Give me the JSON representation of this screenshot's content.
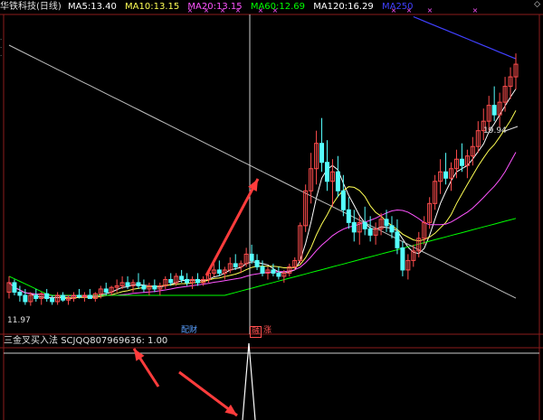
{
  "colors": {
    "bg": "#000000",
    "up": "#ff4d4d",
    "down": "#54ffff",
    "axis": "#8b1c1c",
    "ma5": "#ffffff",
    "ma10": "#ffff54",
    "ma20": "#ff54ff",
    "ma60": "#00ff00",
    "ma120": "#ffffff",
    "ma250": "#4040ff",
    "cursor": "#cfcfcf",
    "arrow": "#ff3c3c",
    "text": "#e0e0e0",
    "label": "#ff4d4d"
  },
  "header": {
    "title": "华铁科技(日线)",
    "ma5_label": "MA5:",
    "ma5_value": "13.40",
    "ma10_label": "MA10:",
    "ma10_value": "13.15",
    "ma20_label": "MA20:",
    "ma20_value": "13.15",
    "ma60_label": "MA60:",
    "ma60_value": "12.69",
    "ma120_label": "MA120:",
    "ma120_value": "16.29",
    "ma250_label": "MA250"
  },
  "price_labels": {
    "high": "19.94",
    "low": "11.97"
  },
  "badges": {
    "b1": "配财",
    "b2": "融",
    "b3": "涨"
  },
  "indicator": {
    "name": "三金叉买入法",
    "code": "SCJQQ807969636:",
    "value": "1.00"
  },
  "scroll_marker": "◇",
  "chart_data": {
    "type": "candlestick",
    "note": "daily candles approximated from screenshot",
    "candles": [
      [
        12.4,
        12.9,
        12.2,
        12.7
      ],
      [
        12.7,
        12.8,
        12.3,
        12.4
      ],
      [
        12.4,
        12.6,
        12.1,
        12.3
      ],
      [
        12.3,
        12.5,
        12.0,
        12.1
      ],
      [
        12.1,
        12.4,
        11.97,
        12.3
      ],
      [
        12.3,
        12.5,
        12.1,
        12.2
      ],
      [
        12.2,
        12.4,
        12.0,
        12.35
      ],
      [
        12.35,
        12.5,
        12.1,
        12.2
      ],
      [
        12.2,
        12.3,
        12.0,
        12.1
      ],
      [
        12.1,
        12.4,
        12.0,
        12.3
      ],
      [
        12.3,
        12.4,
        12.1,
        12.15
      ],
      [
        12.15,
        12.3,
        12.0,
        12.2
      ],
      [
        12.2,
        12.4,
        12.1,
        12.3
      ],
      [
        12.3,
        12.5,
        12.2,
        12.25
      ],
      [
        12.25,
        12.4,
        12.1,
        12.3
      ],
      [
        12.3,
        12.5,
        12.2,
        12.2
      ],
      [
        12.2,
        12.4,
        12.1,
        12.35
      ],
      [
        12.35,
        12.6,
        12.2,
        12.5
      ],
      [
        12.5,
        12.7,
        12.3,
        12.4
      ],
      [
        12.4,
        12.6,
        12.3,
        12.55
      ],
      [
        12.55,
        12.8,
        12.4,
        12.6
      ],
      [
        12.6,
        12.9,
        12.5,
        12.7
      ],
      [
        12.7,
        12.9,
        12.5,
        12.6
      ],
      [
        12.6,
        12.8,
        12.4,
        12.7
      ],
      [
        12.7,
        13.0,
        12.5,
        12.6
      ],
      [
        12.6,
        12.8,
        12.4,
        12.5
      ],
      [
        12.5,
        12.7,
        12.3,
        12.6
      ],
      [
        12.6,
        12.8,
        12.4,
        12.5
      ],
      [
        12.5,
        12.7,
        12.3,
        12.6
      ],
      [
        12.6,
        12.9,
        12.5,
        12.8
      ],
      [
        12.8,
        13.0,
        12.6,
        12.7
      ],
      [
        12.7,
        13.0,
        12.6,
        12.9
      ],
      [
        12.9,
        13.1,
        12.7,
        12.8
      ],
      [
        12.8,
        13.0,
        12.6,
        12.7
      ],
      [
        12.7,
        12.9,
        12.5,
        12.8
      ],
      [
        12.8,
        13.0,
        12.6,
        12.7
      ],
      [
        12.7,
        12.9,
        12.6,
        12.8
      ],
      [
        12.8,
        13.1,
        12.7,
        13.0
      ],
      [
        13.0,
        13.3,
        12.9,
        13.1
      ],
      [
        13.1,
        13.4,
        12.9,
        13.0
      ],
      [
        13.0,
        13.2,
        12.8,
        13.1
      ],
      [
        13.1,
        13.5,
        13.0,
        13.3
      ],
      [
        13.3,
        13.6,
        13.1,
        13.2
      ],
      [
        13.2,
        13.4,
        13.0,
        13.3
      ],
      [
        13.3,
        13.8,
        13.2,
        13.6
      ],
      [
        13.6,
        13.9,
        13.3,
        13.4
      ],
      [
        13.4,
        13.6,
        13.1,
        13.2
      ],
      [
        13.2,
        13.4,
        12.9,
        13.0
      ],
      [
        13.0,
        13.2,
        12.8,
        13.1
      ],
      [
        13.1,
        13.3,
        12.9,
        13.0
      ],
      [
        13.0,
        13.2,
        12.8,
        12.9
      ],
      [
        12.9,
        13.1,
        12.7,
        13.0
      ],
      [
        13.0,
        13.3,
        12.9,
        13.2
      ],
      [
        13.2,
        13.5,
        13.1,
        13.4
      ],
      [
        13.4,
        14.6,
        13.3,
        14.5
      ],
      [
        14.5,
        15.8,
        14.3,
        15.6
      ],
      [
        15.6,
        16.8,
        15.2,
        16.3
      ],
      [
        16.3,
        17.5,
        15.8,
        17.1
      ],
      [
        17.1,
        17.9,
        16.2,
        16.5
      ],
      [
        16.5,
        17.2,
        15.6,
        15.9
      ],
      [
        15.9,
        16.6,
        15.1,
        16.2
      ],
      [
        16.2,
        16.7,
        15.4,
        15.6
      ],
      [
        15.6,
        16.1,
        14.8,
        15.0
      ],
      [
        15.0,
        15.4,
        14.4,
        14.6
      ],
      [
        14.6,
        15.0,
        14.0,
        14.3
      ],
      [
        14.3,
        14.8,
        13.9,
        14.6
      ],
      [
        14.6,
        15.1,
        14.2,
        14.4
      ],
      [
        14.4,
        14.8,
        14.0,
        14.2
      ],
      [
        14.2,
        14.6,
        13.9,
        14.4
      ],
      [
        14.4,
        14.9,
        14.2,
        14.7
      ],
      [
        14.7,
        15.0,
        14.3,
        14.5
      ],
      [
        14.5,
        14.8,
        14.1,
        14.3
      ],
      [
        14.3,
        14.7,
        13.6,
        13.8
      ],
      [
        13.8,
        14.0,
        12.9,
        13.1
      ],
      [
        13.1,
        13.6,
        12.8,
        13.4
      ],
      [
        13.4,
        13.9,
        13.2,
        13.7
      ],
      [
        13.7,
        14.3,
        13.5,
        14.1
      ],
      [
        14.1,
        14.8,
        13.9,
        14.6
      ],
      [
        14.6,
        15.4,
        14.4,
        15.2
      ],
      [
        15.2,
        16.1,
        15.0,
        15.9
      ],
      [
        15.9,
        16.6,
        15.5,
        16.2
      ],
      [
        16.2,
        16.8,
        15.8,
        16.0
      ],
      [
        16.0,
        16.5,
        15.6,
        16.3
      ],
      [
        16.3,
        16.9,
        16.0,
        16.6
      ],
      [
        16.6,
        17.1,
        16.2,
        16.4
      ],
      [
        16.4,
        16.9,
        16.0,
        16.7
      ],
      [
        16.7,
        17.3,
        16.4,
        17.0
      ],
      [
        17.0,
        17.8,
        16.8,
        17.5
      ],
      [
        17.5,
        18.2,
        17.2,
        17.8
      ],
      [
        17.8,
        18.6,
        17.5,
        18.3
      ],
      [
        18.3,
        18.9,
        17.8,
        18.0
      ],
      [
        18.0,
        18.7,
        17.6,
        18.4
      ],
      [
        18.4,
        19.2,
        18.1,
        18.9
      ],
      [
        18.9,
        19.5,
        18.5,
        19.2
      ],
      [
        19.2,
        19.94,
        18.8,
        19.6
      ]
    ],
    "ylim": [
      11.5,
      21.0
    ]
  }
}
